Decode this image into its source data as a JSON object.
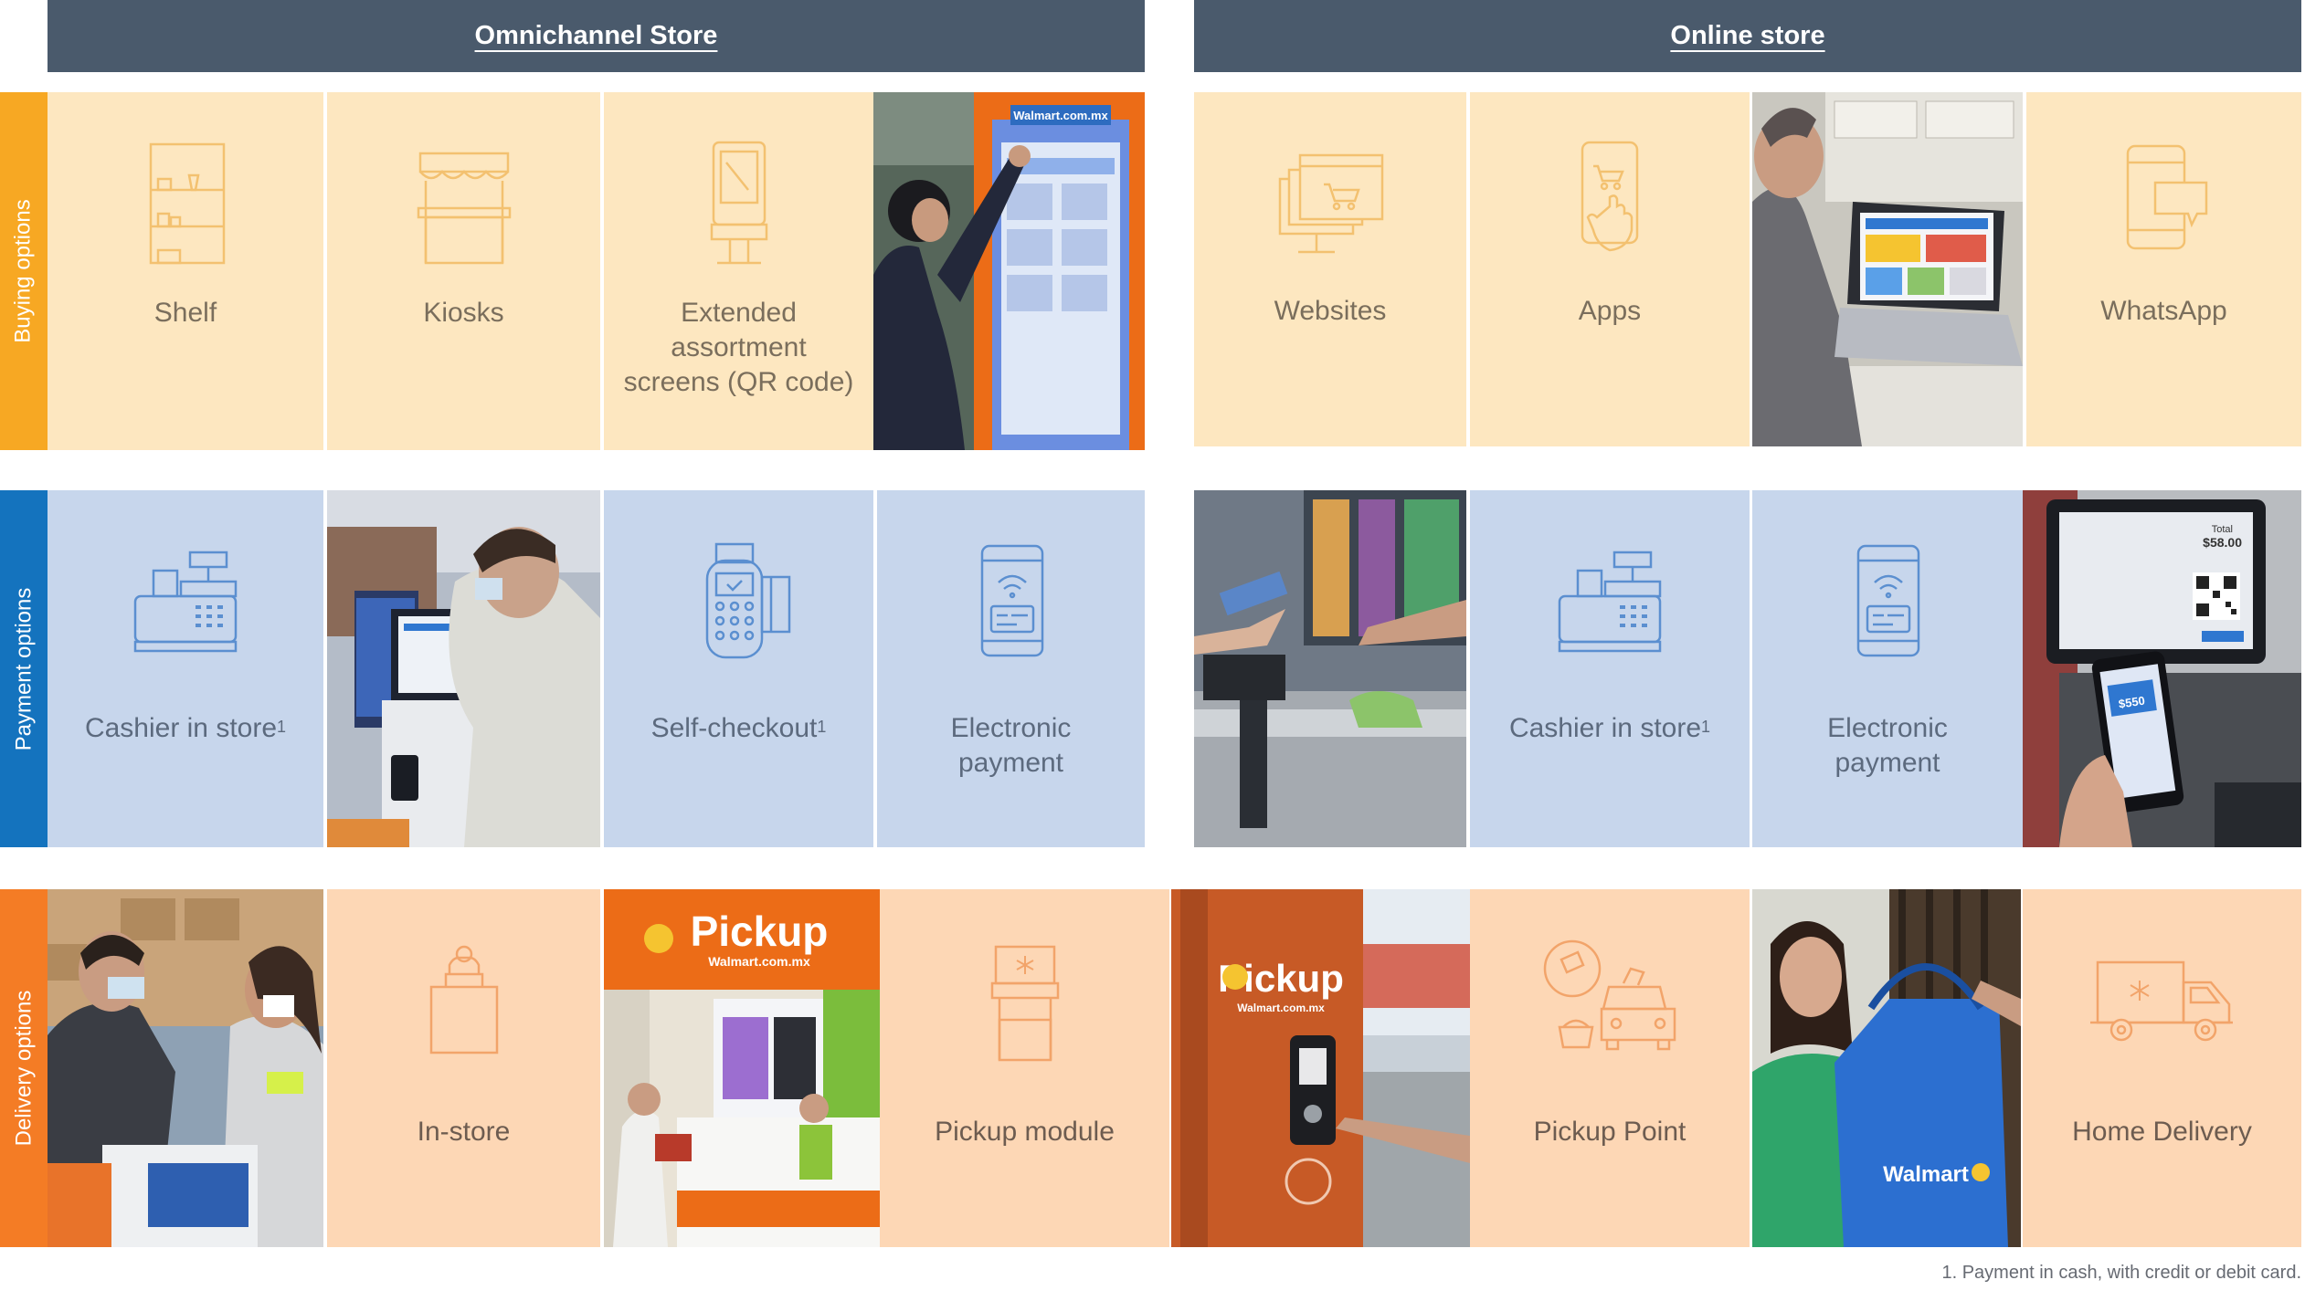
{
  "headers": {
    "omnichannel": "Omnichannel Store",
    "online": "Online store"
  },
  "rows": {
    "buying": "Buying options",
    "payment": "Payment options",
    "delivery": "Delivery options"
  },
  "buying": {
    "shelf": "Shelf",
    "kiosks": "Kiosks",
    "extended_1": "Extended assortment",
    "extended_2": "screens (QR code)",
    "websites": "Websites",
    "apps": "Apps",
    "whatsapp": "WhatsApp"
  },
  "payment": {
    "cashier_store": "Cashier in store",
    "self_checkout": "Self-checkout",
    "electronic_1": "Electronic",
    "electronic_2": "payment",
    "cashier_online": "Cashier in store",
    "electronic_online_1": "Electronic",
    "electronic_online_2": "payment",
    "footnote_mark": "1"
  },
  "delivery": {
    "in_store": "In-store",
    "pickup_module": "Pickup module",
    "pickup_point": "Pickup Point",
    "home_delivery": "Home Delivery"
  },
  "photos": {
    "kiosk_brand": "Walmart.com.mx",
    "pickup_sign": "Pickup",
    "pickup_sub": "Walmart.com.mx",
    "locker_sign": "Pickup",
    "locker_sub": "Walmart.com.mx",
    "bag_brand": "Walmart",
    "screen_total": "Total",
    "screen_amount": "$58.00",
    "phone_amount": "$550"
  },
  "footnote": "1. Payment in cash, with credit or debit card.",
  "colors": {
    "header": "#4a5a6c",
    "buying_bar": "#f7a823",
    "payment_bar": "#1473be",
    "delivery_bar": "#f47c25",
    "buying_tile": "#fde7c0",
    "payment_tile": "#c7d6ec",
    "delivery_tile": "#fdd7b5"
  }
}
